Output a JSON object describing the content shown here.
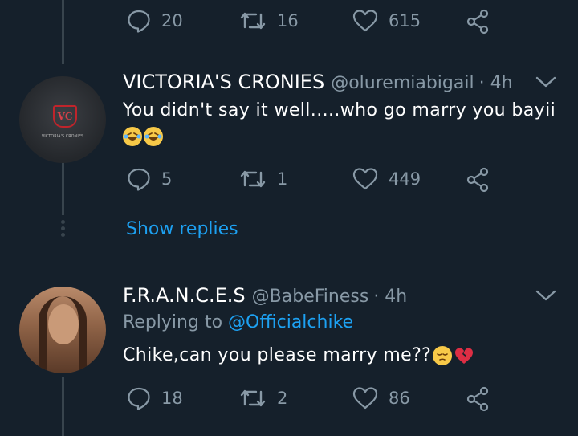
{
  "tweets": [
    {
      "actions": {
        "replies": "20",
        "retweets": "16",
        "likes": "615"
      }
    },
    {
      "display_name": "VICTORIA'S CRONIES",
      "handle": "@oluremiabigail",
      "time": "· 4h",
      "text": "You didn't say it well.....who go marry you bayii",
      "emoji": [
        "rolling-on-floor-laughing",
        "rolling-on-floor-laughing"
      ],
      "avatar_text": "VC",
      "avatar_caption": "VICTORIA'S CRONIES",
      "actions": {
        "replies": "5",
        "retweets": "1",
        "likes": "449"
      },
      "show_replies": "Show replies"
    },
    {
      "display_name": "F.R.A.N.C.E.S",
      "handle": "@BabeFiness",
      "time": "· 4h",
      "replying_label": "Replying to",
      "replying_to": "@Officialchike",
      "text": "Chike,can you please marry me??",
      "emoji": [
        "pensive-face",
        "broken-heart"
      ],
      "actions": {
        "replies": "18",
        "retweets": "2",
        "likes": "86"
      }
    }
  ],
  "colors": {
    "background": "#15202b",
    "muted": "#8899a6",
    "accent": "#1da1f2",
    "divider": "#38444d"
  }
}
